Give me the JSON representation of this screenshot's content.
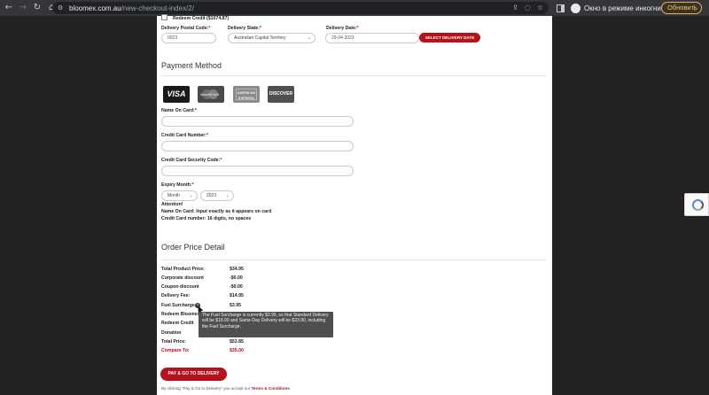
{
  "browser": {
    "url_domain": "bloomex.com.au",
    "url_path": "/new-checkout-index/2/",
    "incognito_label": "Окно в режиме инкогнито",
    "update_label": "Обновить"
  },
  "redeem_credit_top": "Redeem Credit ($1074.87)",
  "delivery": {
    "postal_label": "Delivery Postal Code:",
    "postal_value": "0023",
    "state_label": "Delivery State:",
    "state_value": "Australian Capital Territory",
    "date_label": "Delivery Date:",
    "date_value": "29-04-2023",
    "select_date_button": "SELECT DELIVERY DATE",
    "required_mark": "*"
  },
  "payment": {
    "title": "Payment Method",
    "cards": [
      "VISA",
      "MasterCard",
      "AMERICAN EXPRESS",
      "DISCOVER"
    ],
    "name_label": "Name On Card:",
    "number_label": "Credit Card Number:",
    "security_label": "Credit Card Security Code:",
    "expiry_label": "Expiry Month:",
    "month_value": "Month",
    "year_value": "2023",
    "attention_title": "Attention!",
    "attention_line1": "Name On Card: Input exactly as it appears on card",
    "attention_line2": "Credit Card number: 16 digits, no spaces"
  },
  "order": {
    "title": "Order Price Detail",
    "rows": [
      {
        "label": "Total Product Price:",
        "value": "$34.95"
      },
      {
        "label": "Corporate discount",
        "value": "-$0.00"
      },
      {
        "label": "Coupon discount",
        "value": "-$0.00"
      },
      {
        "label": "Delivery Fee:",
        "value": "$14.95"
      },
      {
        "label": "Fuel Surcharge",
        "value": "$3.95"
      },
      {
        "label": "Redeem Bloomex",
        "value": ""
      },
      {
        "label": "Redeem Credit",
        "value": ""
      },
      {
        "label": "Donation",
        "value": ""
      },
      {
        "label": "Total Price:",
        "value": "$53.85"
      },
      {
        "label": "Compare To:",
        "value": "$35.00"
      }
    ],
    "tooltip": "The Fuel Surcharge is currently $3.95, so that Standard Delivery will be $18.90 and Same-Day Delivery will be $23.90, including the Fuel Surcharge.",
    "pay_button": "PAY & GO TO DELIVERY",
    "terms_prefix": "By clicking \"Pay & Go to Delivery\" you accept our",
    "terms_link": "Terms & Conditions"
  },
  "colors": {
    "accent": "#b5121b",
    "required": "#d0021b"
  }
}
